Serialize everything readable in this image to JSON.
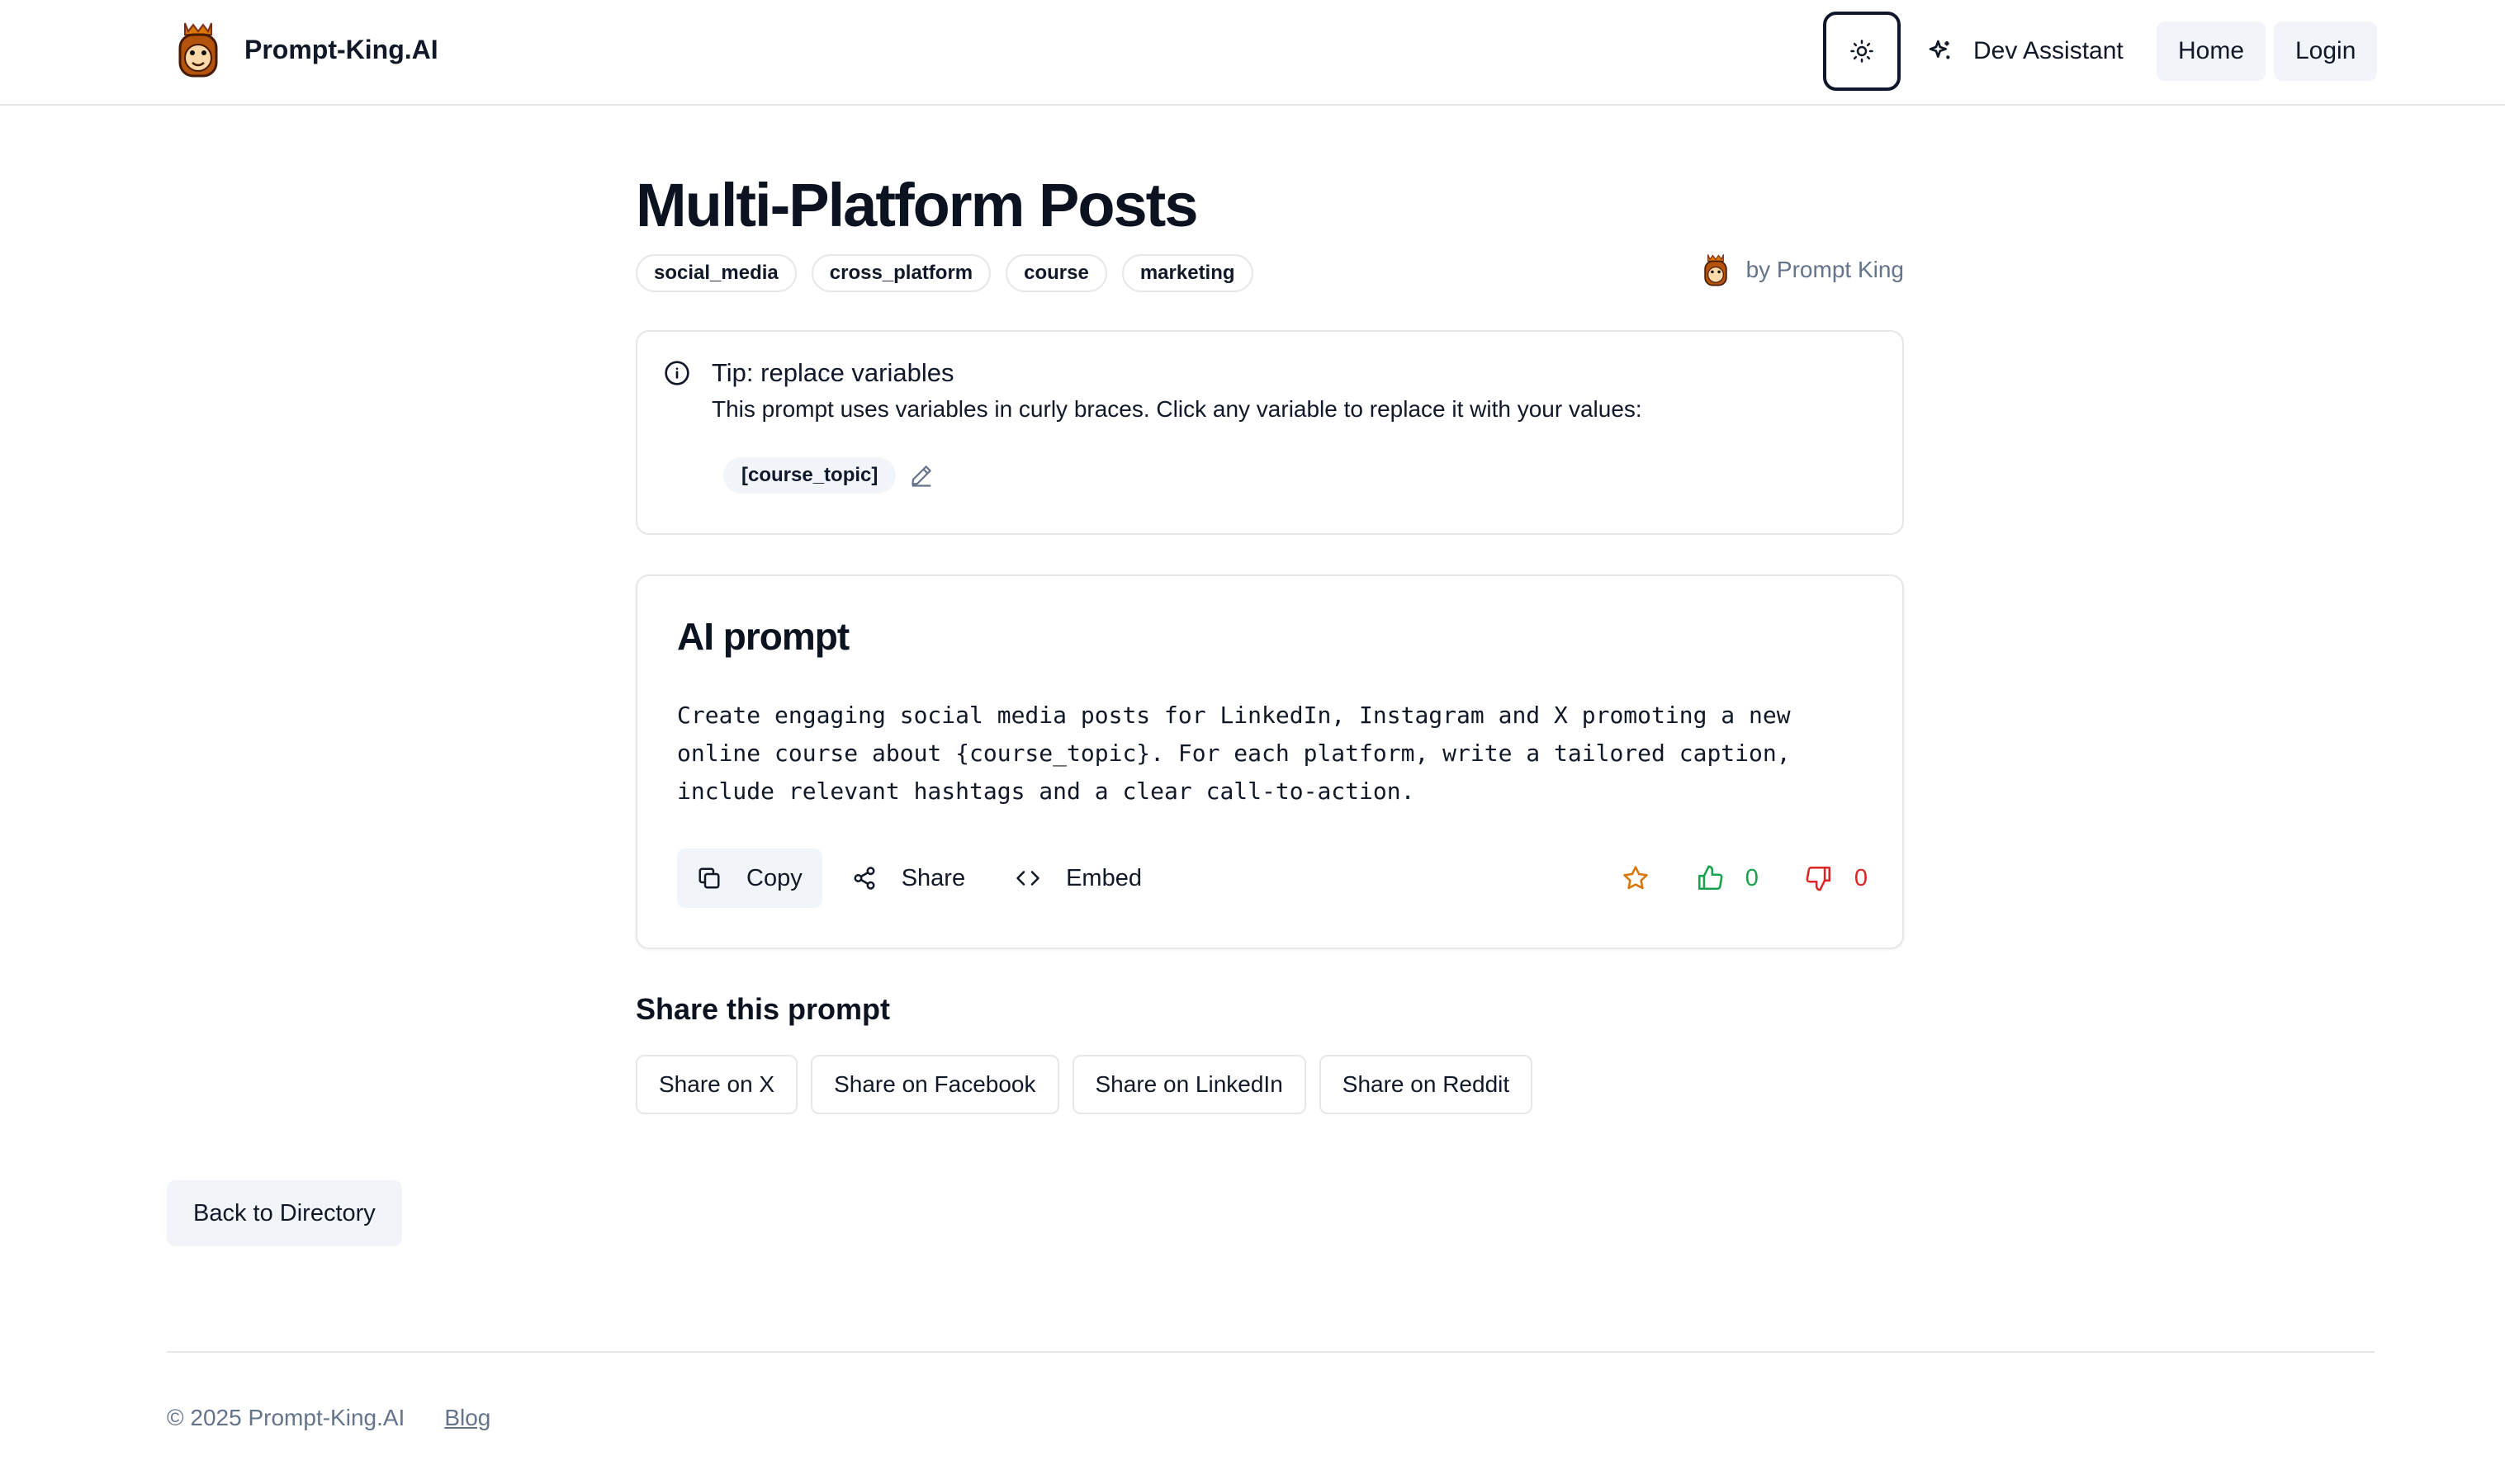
{
  "header": {
    "brand_name": "Prompt-King.AI",
    "theme_toggle_icon": "sun-icon",
    "dev_assistant_label": "Dev Assistant",
    "home_label": "Home",
    "login_label": "Login"
  },
  "prompt": {
    "title": "Multi-Platform Posts",
    "tags": [
      "social_media",
      "cross_platform",
      "course",
      "marketing"
    ],
    "author": "by Prompt King"
  },
  "tip": {
    "title": "Tip: replace variables",
    "description": "This prompt uses variables in curly braces. Click any variable to replace it with your values:",
    "variables": [
      "[course_topic]"
    ]
  },
  "ai_prompt": {
    "heading": "AI prompt",
    "text": "Create engaging social media posts for LinkedIn, Instagram and X promoting a new\nonline course about {course_topic}. For each platform, write a tailored caption,\ninclude relevant hashtags and a clear call-to-action.",
    "copy_label": "Copy",
    "share_label": "Share",
    "embed_label": "Embed",
    "likes": "0",
    "dislikes": "0"
  },
  "share": {
    "heading": "Share this prompt",
    "buttons": [
      "Share on X",
      "Share on Facebook",
      "Share on LinkedIn",
      "Share on Reddit"
    ]
  },
  "back_label": "Back to Directory",
  "footer": {
    "copyright": "© 2025 Prompt-King.AI",
    "blog_label": "Blog"
  },
  "colors": {
    "accent_star": "#d97706",
    "like": "#16a34a",
    "dislike": "#dc2626",
    "muted": "#64748b"
  }
}
